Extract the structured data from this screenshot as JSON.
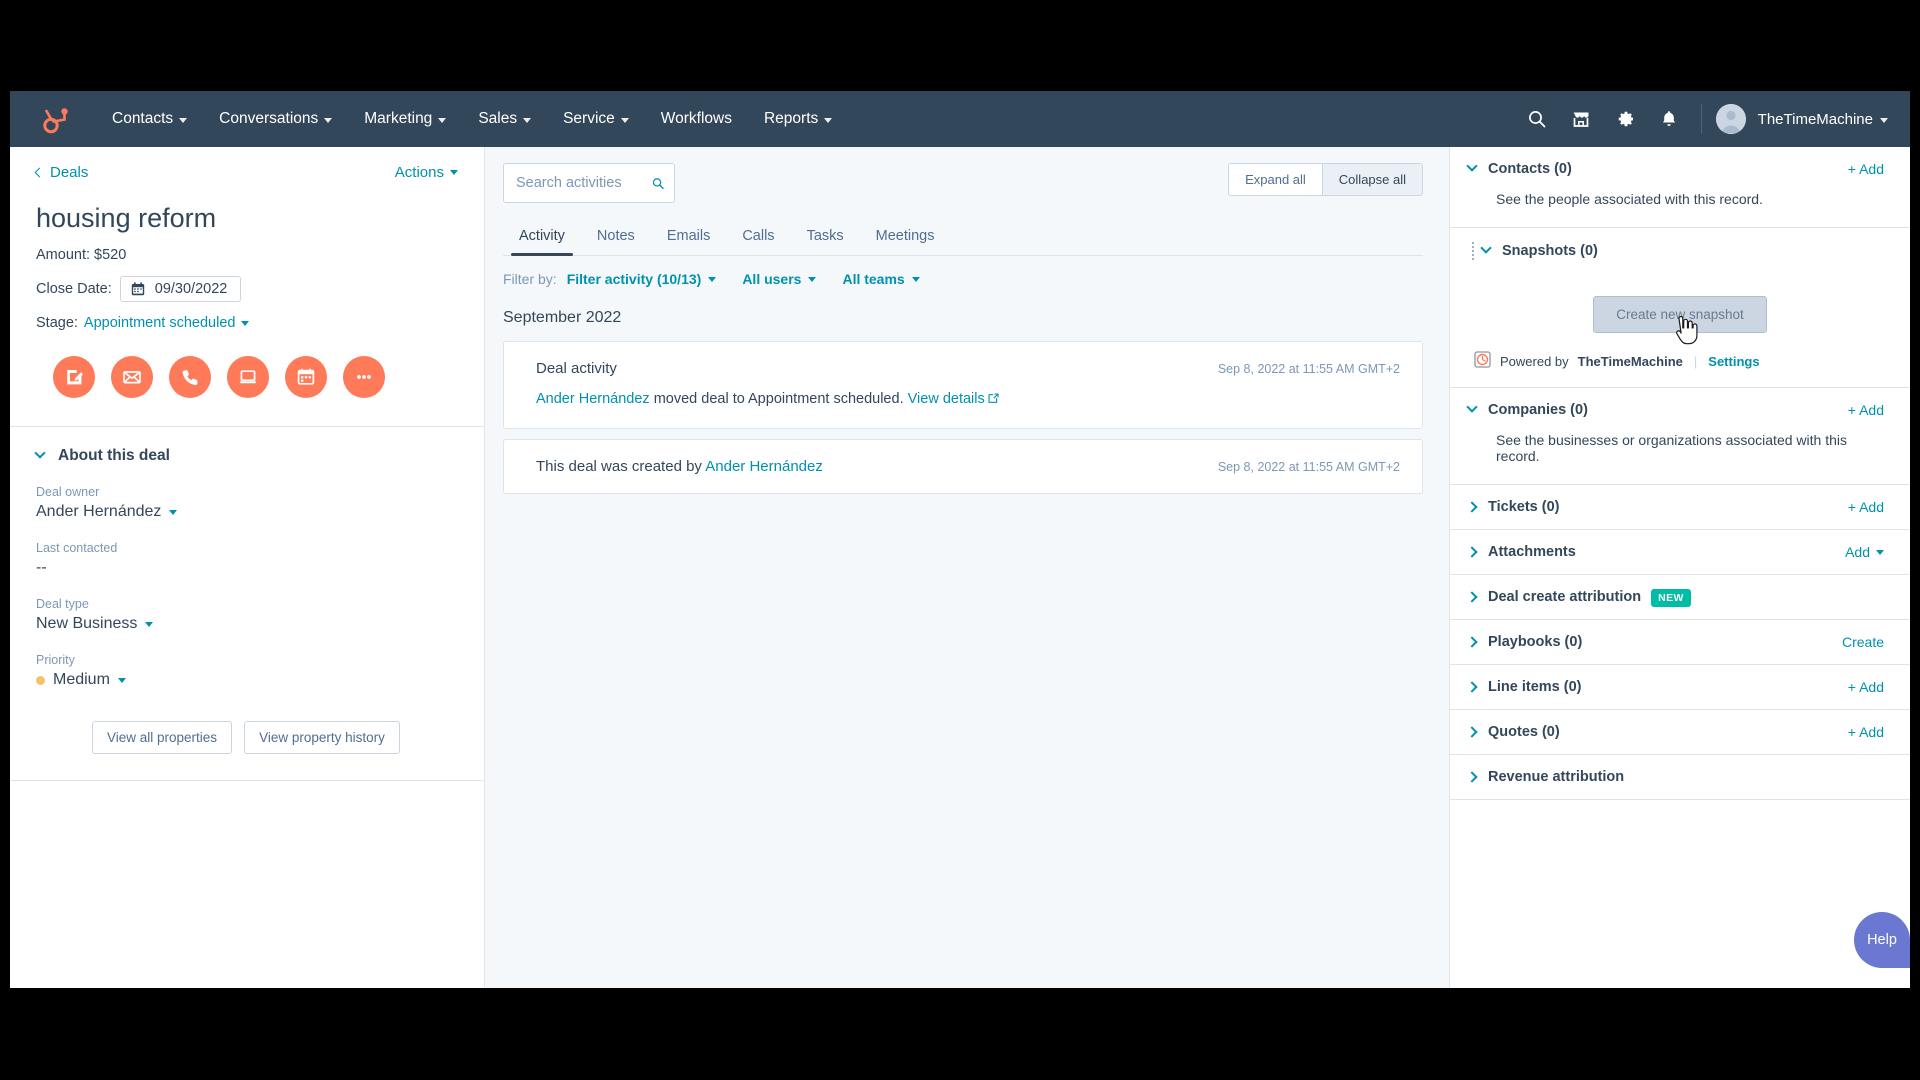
{
  "nav": {
    "logo_icon": "hubspot-sprocket-logo",
    "items": [
      {
        "label": "Contacts",
        "has_caret": true
      },
      {
        "label": "Conversations",
        "has_caret": true
      },
      {
        "label": "Marketing",
        "has_caret": true
      },
      {
        "label": "Sales",
        "has_caret": true
      },
      {
        "label": "Service",
        "has_caret": true
      },
      {
        "label": "Workflows",
        "has_caret": false
      },
      {
        "label": "Reports",
        "has_caret": true
      }
    ],
    "icons": [
      "search-icon",
      "marketplace-icon",
      "settings-gear-icon",
      "notifications-bell-icon"
    ],
    "account_name": "TheTimeMachine"
  },
  "left": {
    "breadcrumb": "Deals",
    "actions_label": "Actions",
    "deal_title": "housing reform",
    "amount_label": "Amount: $520",
    "close_date_label": "Close Date:",
    "close_date_value": "09/30/2022",
    "stage_label": "Stage:",
    "stage_value": "Appointment scheduled",
    "quick_actions": [
      {
        "name": "note-icon"
      },
      {
        "name": "email-icon"
      },
      {
        "name": "call-icon"
      },
      {
        "name": "task-icon"
      },
      {
        "name": "meeting-calendar-icon"
      },
      {
        "name": "more-ellipsis-icon"
      }
    ],
    "about_title": "About this deal",
    "properties": [
      {
        "label": "Deal owner",
        "value": "Ander Hernández",
        "dropdown": true,
        "dot": false
      },
      {
        "label": "Last contacted",
        "value": "--",
        "dropdown": false,
        "dot": false
      },
      {
        "label": "Deal type",
        "value": "New Business",
        "dropdown": true,
        "dot": false
      },
      {
        "label": "Priority",
        "value": "Medium",
        "dropdown": true,
        "dot": true
      }
    ],
    "view_all_properties": "View all properties",
    "view_property_history": "View property history"
  },
  "center": {
    "search_placeholder": "Search activities",
    "search_value": "",
    "expand_all": "Expand all",
    "collapse_all": "Collapse all",
    "tabs": [
      {
        "label": "Activity",
        "active": true
      },
      {
        "label": "Notes",
        "active": false
      },
      {
        "label": "Emails",
        "active": false
      },
      {
        "label": "Calls",
        "active": false
      },
      {
        "label": "Tasks",
        "active": false
      },
      {
        "label": "Meetings",
        "active": false
      }
    ],
    "filter_by_label": "Filter by:",
    "filters": [
      {
        "label": "Filter activity (10/13)"
      },
      {
        "label": "All users"
      },
      {
        "label": "All teams"
      }
    ],
    "month_header": "September 2022",
    "activities": [
      {
        "title": "Deal activity",
        "timestamp": "Sep 8, 2022 at 11:55 AM GMT+2",
        "actor": "Ander Hernández",
        "body_text": " moved deal to Appointment scheduled. ",
        "details_link": "View details",
        "has_body": true
      },
      {
        "title": "",
        "timestamp": "Sep 8, 2022 at 11:55 AM GMT+2",
        "prefix": "This deal was created by ",
        "actor": "Ander Hernández",
        "has_body": false
      }
    ]
  },
  "right": {
    "sections": [
      {
        "title": "Contacts (0)",
        "action": "+ Add",
        "expanded": true,
        "grip": false,
        "body": "See the people associated with this record.",
        "badge": null,
        "action_caret": false
      },
      {
        "title": "Snapshots (0)",
        "action": "",
        "expanded": true,
        "grip": true,
        "body": "",
        "badge": null,
        "action_caret": false
      },
      {
        "title": "Companies (0)",
        "action": "+ Add",
        "expanded": true,
        "grip": false,
        "body": "See the businesses or organizations associated with this record.",
        "badge": null,
        "action_caret": false
      },
      {
        "title": "Tickets (0)",
        "action": "+ Add",
        "expanded": false,
        "grip": false,
        "body": "",
        "badge": null,
        "action_caret": false
      },
      {
        "title": "Attachments",
        "action": "Add",
        "expanded": false,
        "grip": false,
        "body": "",
        "badge": null,
        "action_caret": true
      },
      {
        "title": "Deal create attribution",
        "action": "",
        "expanded": false,
        "grip": false,
        "body": "",
        "badge": "NEW",
        "action_caret": false
      },
      {
        "title": "Playbooks (0)",
        "action": "Create",
        "expanded": false,
        "grip": false,
        "body": "",
        "badge": null,
        "action_caret": false
      },
      {
        "title": "Line items (0)",
        "action": "+ Add",
        "expanded": false,
        "grip": false,
        "body": "",
        "badge": null,
        "action_caret": false
      },
      {
        "title": "Quotes (0)",
        "action": "+ Add",
        "expanded": false,
        "grip": false,
        "body": "",
        "badge": null,
        "action_caret": false
      },
      {
        "title": "Revenue attribution",
        "action": "",
        "expanded": false,
        "grip": false,
        "body": "",
        "badge": null,
        "action_caret": false
      }
    ],
    "snapshot_button": "Create new snapshot",
    "powered_prefix": "Powered by ",
    "powered_brand": "TheTimeMachine",
    "settings_link": "Settings",
    "help_label": "Help"
  },
  "colors": {
    "nav_bg": "#33475b",
    "accent_orange": "#ff7a59",
    "link_teal": "#0091ae",
    "badge_green": "#00bda5",
    "help_purple": "#6a78d1",
    "page_bg": "#f5f8fa",
    "border": "#dfe3eb"
  }
}
